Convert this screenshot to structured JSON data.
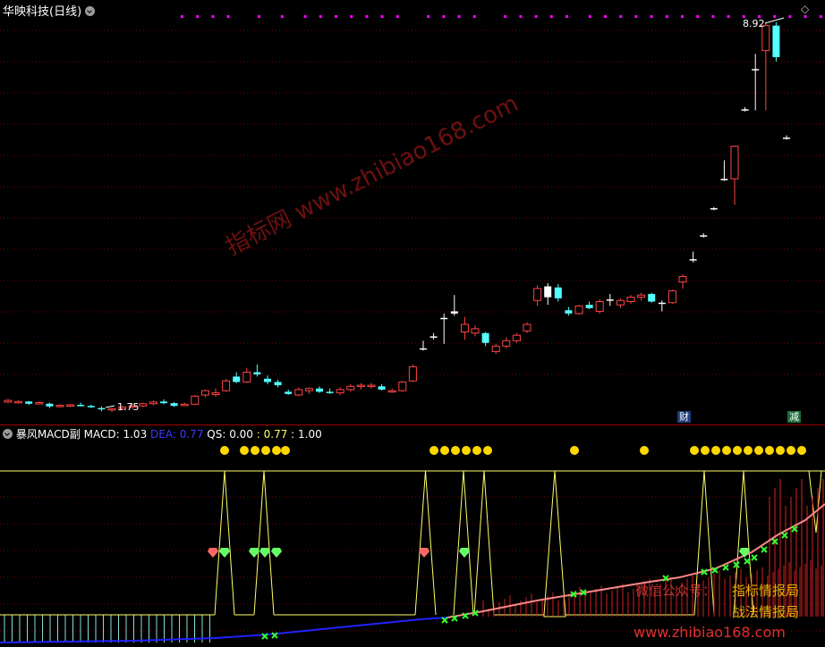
{
  "main_panel": {
    "stock_name": "华映科技",
    "period": "(日线)",
    "high_label": "8.92",
    "low_label": "1.75",
    "markers": [
      "财",
      "减"
    ],
    "diamond_symbol": "◇"
  },
  "sub_panel": {
    "indicator_name": "暴风MACD副",
    "macd_label": "MACD:",
    "macd_value": "1.03",
    "dea_label": "DEA:",
    "dea_value": "0.77",
    "qs_label": "QS:",
    "qs_values": [
      "0.00",
      ": 0.77",
      ": 1.00"
    ]
  },
  "watermarks": {
    "diagonal": "指标网 www.zhibiao168.com",
    "wechat": "微信公众号：",
    "brand1": "指标情报局",
    "brand2": "战法情报局",
    "url": "www.zhibiao168.com"
  },
  "colors": {
    "background": "#000000",
    "up": "#ff4444",
    "down": "#54ffff",
    "yellow": "#ffff66",
    "gold_dot": "#ffd700",
    "magenta": "#ff00ff",
    "green_x": "#33ff33",
    "pink_line": "#ff8888",
    "blue_line": "#2222ff",
    "grid": "#7a0000"
  },
  "chart_data": {
    "type": "candlestick",
    "title": "华映科技 (日线)",
    "y_range": [
      1.6,
      9.2
    ],
    "candles": [
      {
        "o": 1.96,
        "h": 1.99,
        "l": 1.91,
        "c": 1.93,
        "dir": "up"
      },
      {
        "o": 1.93,
        "h": 1.96,
        "l": 1.9,
        "c": 1.94,
        "dir": "up"
      },
      {
        "o": 1.94,
        "h": 1.95,
        "l": 1.88,
        "c": 1.9,
        "dir": "down"
      },
      {
        "o": 1.92,
        "h": 1.94,
        "l": 1.89,
        "c": 1.91,
        "dir": "up"
      },
      {
        "o": 1.9,
        "h": 1.92,
        "l": 1.82,
        "c": 1.85,
        "dir": "down"
      },
      {
        "o": 1.86,
        "h": 1.89,
        "l": 1.83,
        "c": 1.87,
        "dir": "up"
      },
      {
        "o": 1.87,
        "h": 1.9,
        "l": 1.84,
        "c": 1.88,
        "dir": "up"
      },
      {
        "o": 1.88,
        "h": 1.92,
        "l": 1.85,
        "c": 1.86,
        "dir": "down"
      },
      {
        "o": 1.86,
        "h": 1.88,
        "l": 1.82,
        "c": 1.84,
        "dir": "down"
      },
      {
        "o": 1.82,
        "h": 1.85,
        "l": 1.76,
        "c": 1.8,
        "dir": "down"
      },
      {
        "o": 1.79,
        "h": 1.82,
        "l": 1.75,
        "c": 1.81,
        "dir": "up"
      },
      {
        "o": 1.81,
        "h": 1.86,
        "l": 1.78,
        "c": 1.84,
        "dir": "up"
      },
      {
        "o": 1.84,
        "h": 1.9,
        "l": 1.8,
        "c": 1.86,
        "dir": "up"
      },
      {
        "o": 1.86,
        "h": 1.92,
        "l": 1.84,
        "c": 1.9,
        "dir": "up"
      },
      {
        "o": 1.9,
        "h": 1.96,
        "l": 1.87,
        "c": 1.93,
        "dir": "up"
      },
      {
        "o": 1.94,
        "h": 1.98,
        "l": 1.89,
        "c": 1.91,
        "dir": "down"
      },
      {
        "o": 1.91,
        "h": 1.93,
        "l": 1.84,
        "c": 1.86,
        "dir": "down"
      },
      {
        "o": 1.88,
        "h": 1.92,
        "l": 1.86,
        "c": 1.89,
        "dir": "up"
      },
      {
        "o": 1.89,
        "h": 2.06,
        "l": 1.88,
        "c": 2.04,
        "dir": "up"
      },
      {
        "o": 2.06,
        "h": 2.16,
        "l": 2.02,
        "c": 2.14,
        "dir": "up"
      },
      {
        "o": 2.1,
        "h": 2.18,
        "l": 2.03,
        "c": 2.07,
        "dir": "up"
      },
      {
        "o": 2.14,
        "h": 2.36,
        "l": 2.12,
        "c": 2.32,
        "dir": "up"
      },
      {
        "o": 2.4,
        "h": 2.48,
        "l": 2.28,
        "c": 2.3,
        "dir": "down"
      },
      {
        "o": 2.3,
        "h": 2.56,
        "l": 2.28,
        "c": 2.48,
        "dir": "up"
      },
      {
        "o": 2.48,
        "h": 2.62,
        "l": 2.4,
        "c": 2.44,
        "dir": "down"
      },
      {
        "o": 2.36,
        "h": 2.42,
        "l": 2.26,
        "c": 2.3,
        "dir": "down"
      },
      {
        "o": 2.3,
        "h": 2.34,
        "l": 2.2,
        "c": 2.24,
        "dir": "down"
      },
      {
        "o": 2.12,
        "h": 2.16,
        "l": 2.06,
        "c": 2.08,
        "dir": "down"
      },
      {
        "o": 2.06,
        "h": 2.2,
        "l": 2.04,
        "c": 2.16,
        "dir": "up"
      },
      {
        "o": 2.14,
        "h": 2.2,
        "l": 2.08,
        "c": 2.18,
        "dir": "up"
      },
      {
        "o": 2.18,
        "h": 2.22,
        "l": 2.1,
        "c": 2.12,
        "dir": "down"
      },
      {
        "o": 2.12,
        "h": 2.18,
        "l": 2.08,
        "c": 2.1,
        "dir": "down"
      },
      {
        "o": 2.1,
        "h": 2.2,
        "l": 2.06,
        "c": 2.16,
        "dir": "up"
      },
      {
        "o": 2.16,
        "h": 2.26,
        "l": 2.12,
        "c": 2.22,
        "dir": "up"
      },
      {
        "o": 2.22,
        "h": 2.28,
        "l": 2.16,
        "c": 2.24,
        "dir": "up"
      },
      {
        "o": 2.24,
        "h": 2.28,
        "l": 2.18,
        "c": 2.22,
        "dir": "up"
      },
      {
        "o": 2.22,
        "h": 2.26,
        "l": 2.14,
        "c": 2.16,
        "dir": "down"
      },
      {
        "o": 2.14,
        "h": 2.18,
        "l": 2.1,
        "c": 2.12,
        "dir": "up"
      },
      {
        "o": 2.14,
        "h": 2.32,
        "l": 2.12,
        "c": 2.3,
        "dir": "up"
      },
      {
        "o": 2.32,
        "h": 2.62,
        "l": 2.3,
        "c": 2.58,
        "dir": "up"
      },
      {
        "o": 2.9,
        "h": 3.06,
        "l": 2.88,
        "c": 2.92,
        "dir": "flat"
      },
      {
        "o": 3.12,
        "h": 3.2,
        "l": 3.08,
        "c": 3.14,
        "dir": "flat"
      },
      {
        "o": 3.48,
        "h": 3.56,
        "l": 3.0,
        "c": 3.46,
        "dir": "flat"
      },
      {
        "o": 3.6,
        "h": 3.9,
        "l": 3.52,
        "c": 3.56,
        "dir": "flat"
      },
      {
        "o": 3.22,
        "h": 3.5,
        "l": 3.08,
        "c": 3.36,
        "dir": "up"
      },
      {
        "o": 3.28,
        "h": 3.34,
        "l": 3.14,
        "c": 3.2,
        "dir": "up"
      },
      {
        "o": 3.2,
        "h": 3.22,
        "l": 2.96,
        "c": 3.02,
        "dir": "down"
      },
      {
        "o": 2.86,
        "h": 3.0,
        "l": 2.82,
        "c": 2.96,
        "dir": "up"
      },
      {
        "o": 2.96,
        "h": 3.12,
        "l": 2.92,
        "c": 3.06,
        "dir": "up"
      },
      {
        "o": 3.06,
        "h": 3.2,
        "l": 3.02,
        "c": 3.16,
        "dir": "up"
      },
      {
        "o": 3.24,
        "h": 3.4,
        "l": 3.2,
        "c": 3.36,
        "dir": "up"
      },
      {
        "o": 3.8,
        "h": 4.08,
        "l": 3.7,
        "c": 4.02,
        "dir": "up"
      },
      {
        "o": 4.06,
        "h": 4.12,
        "l": 3.72,
        "c": 3.86,
        "dir": "flat"
      },
      {
        "o": 4.04,
        "h": 4.1,
        "l": 3.78,
        "c": 3.84,
        "dir": "down"
      },
      {
        "o": 3.62,
        "h": 3.68,
        "l": 3.52,
        "c": 3.56,
        "dir": "down"
      },
      {
        "o": 3.56,
        "h": 3.72,
        "l": 3.54,
        "c": 3.7,
        "dir": "up"
      },
      {
        "o": 3.72,
        "h": 3.78,
        "l": 3.64,
        "c": 3.66,
        "dir": "down"
      },
      {
        "o": 3.6,
        "h": 3.82,
        "l": 3.56,
        "c": 3.78,
        "dir": "up"
      },
      {
        "o": 3.8,
        "h": 3.92,
        "l": 3.7,
        "c": 3.82,
        "dir": "flat"
      },
      {
        "o": 3.72,
        "h": 3.84,
        "l": 3.66,
        "c": 3.8,
        "dir": "up"
      },
      {
        "o": 3.78,
        "h": 3.9,
        "l": 3.74,
        "c": 3.86,
        "dir": "up"
      },
      {
        "o": 3.86,
        "h": 3.94,
        "l": 3.8,
        "c": 3.9,
        "dir": "up"
      },
      {
        "o": 3.92,
        "h": 3.94,
        "l": 3.76,
        "c": 3.78,
        "dir": "down"
      },
      {
        "o": 3.74,
        "h": 3.8,
        "l": 3.6,
        "c": 3.76,
        "dir": "flat"
      },
      {
        "o": 3.76,
        "h": 4.0,
        "l": 3.74,
        "c": 3.98,
        "dir": "up"
      },
      {
        "o": 4.14,
        "h": 4.28,
        "l": 4.02,
        "c": 4.24,
        "dir": "up"
      },
      {
        "o": 4.56,
        "h": 4.7,
        "l": 4.5,
        "c": 4.56,
        "dir": "flat"
      },
      {
        "o": 5.0,
        "h": 5.04,
        "l": 4.96,
        "c": 5.0,
        "dir": "flat"
      },
      {
        "o": 5.5,
        "h": 5.52,
        "l": 5.46,
        "c": 5.5,
        "dir": "flat"
      },
      {
        "o": 6.04,
        "h": 6.38,
        "l": 6.0,
        "c": 6.04,
        "dir": "flat"
      },
      {
        "o": 6.04,
        "h": 6.64,
        "l": 5.56,
        "c": 6.64,
        "dir": "up"
      },
      {
        "o": 7.32,
        "h": 7.36,
        "l": 7.28,
        "c": 7.32,
        "dir": "flat"
      },
      {
        "o": 8.06,
        "h": 8.34,
        "l": 7.3,
        "c": 8.06,
        "dir": "flat"
      },
      {
        "o": 8.4,
        "h": 8.92,
        "l": 7.3,
        "c": 8.86,
        "dir": "up"
      },
      {
        "o": 8.86,
        "h": 8.92,
        "l": 8.2,
        "c": 8.28,
        "dir": "down"
      },
      {
        "o": 6.8,
        "h": 6.84,
        "l": 6.76,
        "c": 6.8,
        "dir": "flat"
      }
    ],
    "sub_indicator": {
      "name": "暴风MACD副",
      "MACD": 1.03,
      "DEA": 0.77,
      "QS": [
        0.0,
        0.77,
        1.0
      ]
    }
  }
}
